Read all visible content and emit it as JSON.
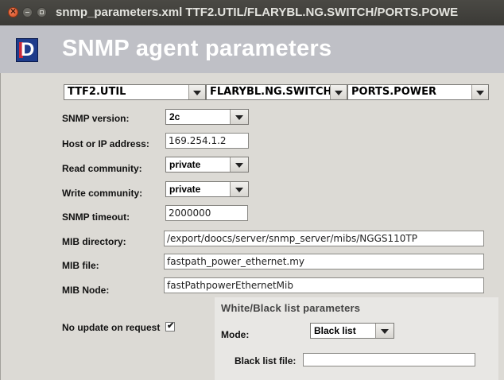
{
  "window": {
    "title": "snmp_parameters.xml  TTF2.UTIL/FLARYBL.NG.SWITCH/PORTS.POWE"
  },
  "header": {
    "title": "SNMP agent parameters",
    "logo_letter": "D"
  },
  "selectors": {
    "facility": "TTF2.UTIL",
    "device": "FLARYBL.NG.SWITCH",
    "location": "PORTS.POWER"
  },
  "form": {
    "snmp_version": {
      "label": "SNMP version:",
      "value": "2c"
    },
    "host": {
      "label": "Host or IP address:",
      "value": "169.254.1.2"
    },
    "read_community": {
      "label": "Read community:",
      "value": "private"
    },
    "write_community": {
      "label": "Write community:",
      "value": "private"
    },
    "timeout": {
      "label": "SNMP timeout:",
      "value": "2000000"
    },
    "mib_directory": {
      "label": "MIB directory:",
      "value": "/export/doocs/server/snmp_server/mibs/NGGS110TP"
    },
    "mib_file": {
      "label": "MIB file:",
      "value": "fastpath_power_ethernet.my"
    },
    "mib_node": {
      "label": "MIB Node:",
      "value": "fastPathpowerEthernetMib"
    },
    "no_update": {
      "label": "No update on request",
      "checked": true,
      "mark": "✔"
    }
  },
  "whitelist": {
    "title": "White/Black list parameters",
    "mode_label": "Mode:",
    "mode_value": "Black list",
    "file_label": "Black list file:",
    "file_value": ""
  }
}
